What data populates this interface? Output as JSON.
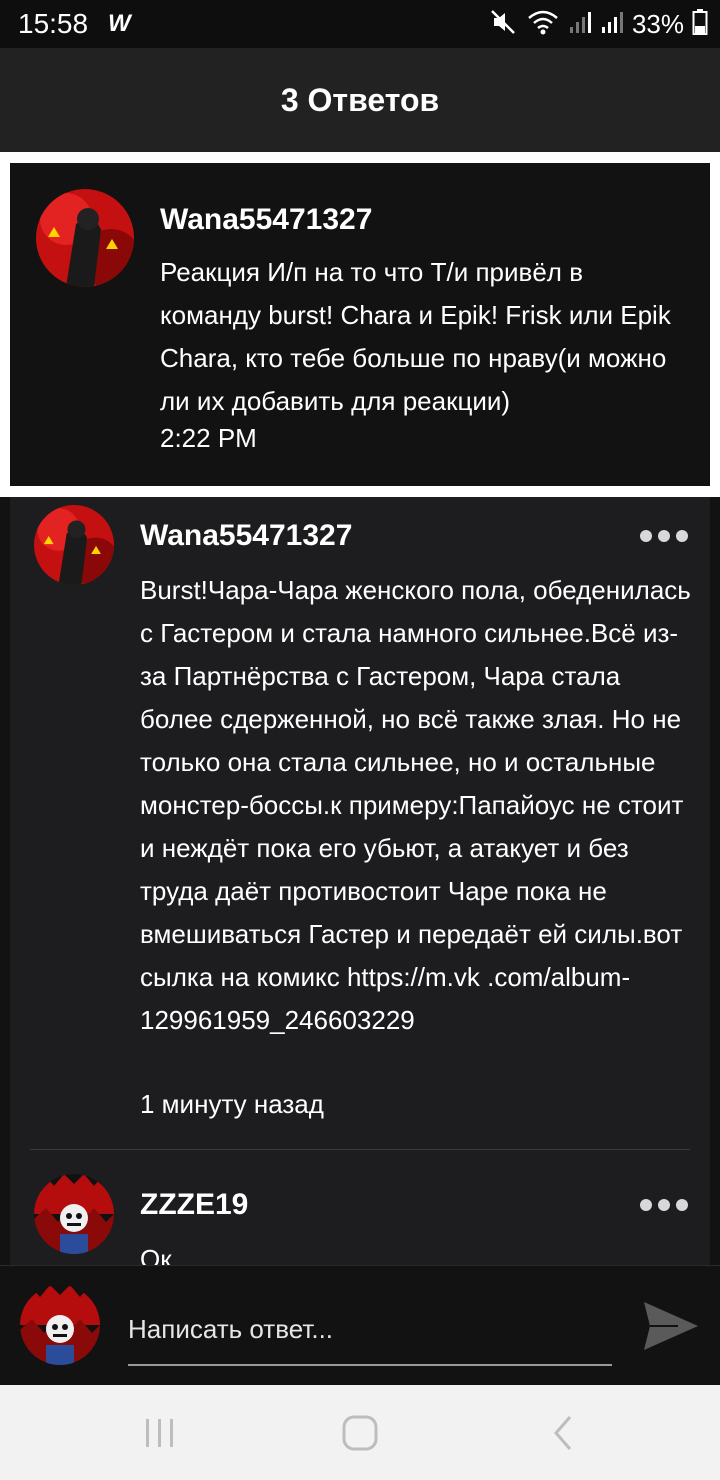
{
  "status_bar": {
    "time": "15:58",
    "app_icon": "W",
    "icons": [
      "mute-icon",
      "wifi-icon",
      "signal-icon",
      "signal-icon"
    ],
    "battery": "33%"
  },
  "header": {
    "title": "3 Ответов"
  },
  "parent_comment": {
    "username": "Wana55471327",
    "text": "Реакция И/п на то что Т/и привёл в команду burst! Chara и Epik! Frisk или Epik Chara, кто тебе больше по нраву(и можно ли их добавить для реакции)",
    "time": "2:22 PM"
  },
  "replies": [
    {
      "username": "Wana55471327",
      "text": "Burst!Чара-Чара женского пола, обеденилась с Гастером и стала намного сильнее.Всё из-за Партнёрства с Гастером, Чара стала более сдерженной, но всё также злая. Но не только она стала сильнее, но и остальные монстер-боссы.к примеру:Папайоус не стоит и неждёт пока его убьют, а атакует и без труда даёт противостоит Чаре пока не вмешиваться Гастер и передаёт ей силы.вот сылка на комикс https://m.vk .com/album-129961959_246603229",
      "time": "1 минуту назад"
    },
    {
      "username": "ZZZE19",
      "text": "Ок",
      "time": ""
    }
  ],
  "composer": {
    "placeholder": "Написать ответ..."
  },
  "colors": {
    "background": "#121212",
    "header": "#222222",
    "replies_background": "#1d1d1f",
    "nav_bar": "#f2f2f2"
  }
}
